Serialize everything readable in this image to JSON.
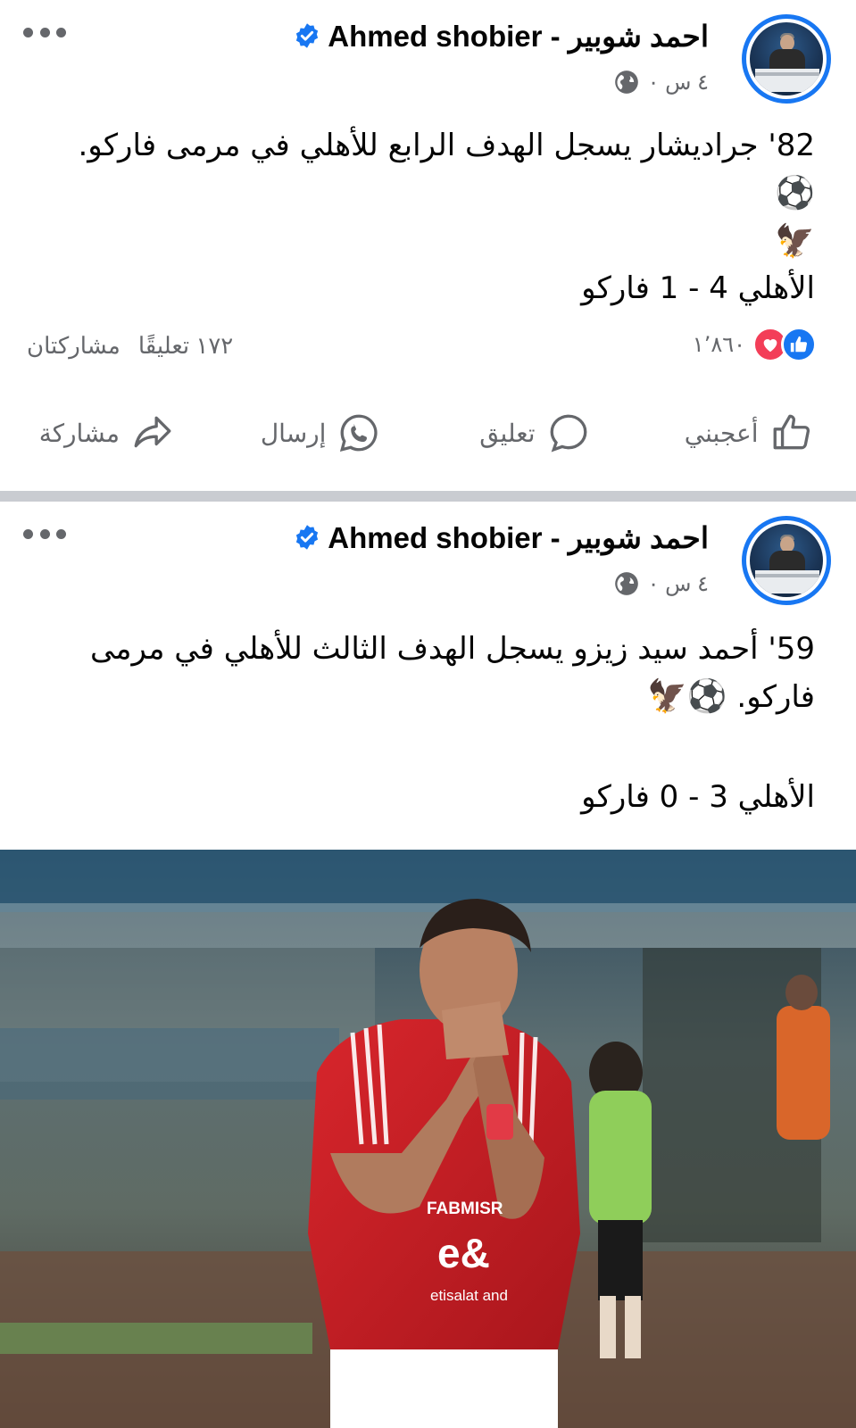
{
  "posts": [
    {
      "author": "Ahmed shobier - احمد شوبير",
      "time": "٤ س ٠",
      "text_line1": "82' جراديشار يسجل الهدف الرابع للأهلي في مرمى فاركو.",
      "score": "الأهلي 4 - 1 فاركو",
      "reactions_count": "١٬٨٦٠",
      "comments": "١٧٢ تعليقًا",
      "shares": "مشاركتان",
      "actions": {
        "like": "أعجبني",
        "comment": "تعليق",
        "send": "إرسال",
        "share": "مشاركة"
      }
    },
    {
      "author": "Ahmed shobier - احمد شوبير",
      "time": "٤ س ٠",
      "text_line1": "59' أحمد سيد زيزو يسجل الهدف الثالث للأهلي في مرمى",
      "text_line2": "فاركو.",
      "score": "الأهلي 3 - 0 فاركو",
      "photo_texts": {
        "sponsor": "FABMISR",
        "brand": "e&",
        "brand_sub": "etisalat and"
      }
    }
  ],
  "icons": {
    "verified": "verified-badge-icon",
    "globe": "globe-icon",
    "more": "more-options-icon",
    "like": "thumbs-up-icon",
    "love": "heart-icon",
    "comment": "comment-bubble-icon",
    "send": "whatsapp-icon",
    "share": "share-arrow-icon",
    "ball": "soccer-ball-emoji",
    "eagle": "eagle-emoji"
  },
  "colors": {
    "accent": "#1877f2",
    "love": "#f33e58",
    "secondary_text": "#65676b",
    "divider": "#c9ccd1"
  }
}
